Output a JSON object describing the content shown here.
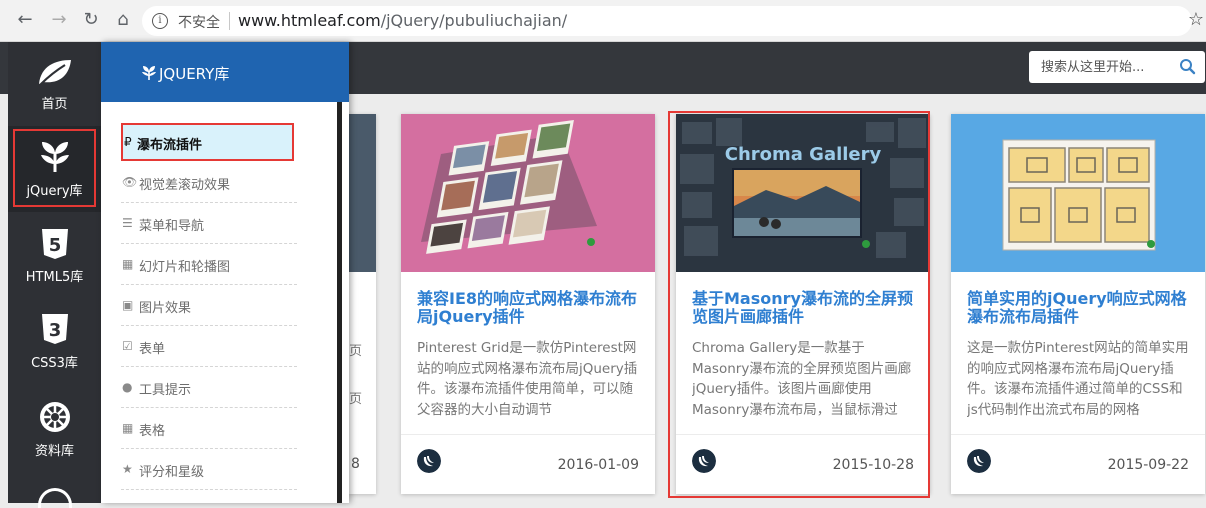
{
  "browser": {
    "insecure_label": "不安全",
    "url_host": "www.htmleaf.com",
    "url_path": "/jQuery/pubuliuchajian/"
  },
  "search": {
    "placeholder": "搜索从这里开始..."
  },
  "rail": [
    {
      "label": "首页",
      "icon": "leaf-icon"
    },
    {
      "label": "jQuery库",
      "icon": "sprout-icon"
    },
    {
      "label": "HTML5库",
      "icon": "html5-icon"
    },
    {
      "label": "CSS3库",
      "icon": "css3-icon"
    },
    {
      "label": "资料库",
      "icon": "empire-icon"
    }
  ],
  "panel": {
    "title": "JQUERY库",
    "items": [
      {
        "label": "瀑布流插件",
        "icon": "₽"
      },
      {
        "label": "视觉差滚动效果",
        "icon": "👁"
      },
      {
        "label": "菜单和导航",
        "icon": "☰"
      },
      {
        "label": "幻灯片和轮播图",
        "icon": "▦"
      },
      {
        "label": "图片效果",
        "icon": "▣"
      },
      {
        "label": "表单",
        "icon": "☑"
      },
      {
        "label": "工具提示",
        "icon": "●"
      },
      {
        "label": "表格",
        "icon": "▦"
      },
      {
        "label": "评分和星级",
        "icon": "★"
      }
    ]
  },
  "peek_date_fragment": "8",
  "cards": [
    {
      "title": "兼容IE8的响应式网格瀑布流布局jQuery插件",
      "desc": "Pinterest Grid是一款仿Pinterest网站的响应式网格瀑布流布局jQuery插件。该瀑布流插件使用简单，可以随父容器的大小自动调节",
      "date": "2016-01-09"
    },
    {
      "title": "基于Masonry瀑布流的全屏预览图片画廊插件",
      "thumb_text": "Chroma Gallery",
      "desc": "Chroma Gallery是一款基于Masonry瀑布流的全屏预览图片画廊jQuery插件。该图片画廊使用Masonry瀑布流布局，当鼠标滑过",
      "date": "2015-10-28"
    },
    {
      "title": "简单实用的jQuery响应式网格瀑布流布局插件",
      "desc": "这是一款仿Pinterest网站的简单实用的响应式网格瀑布流布局jQuery插件。该瀑布流插件通过简单的CSS和js代码制作出流式布局的网格",
      "date": "2015-09-22"
    }
  ],
  "colors": {
    "topbar": "#34373c",
    "panel_head": "#1f64b0",
    "link": "#2f7fd1",
    "highlight": "#e53935"
  }
}
